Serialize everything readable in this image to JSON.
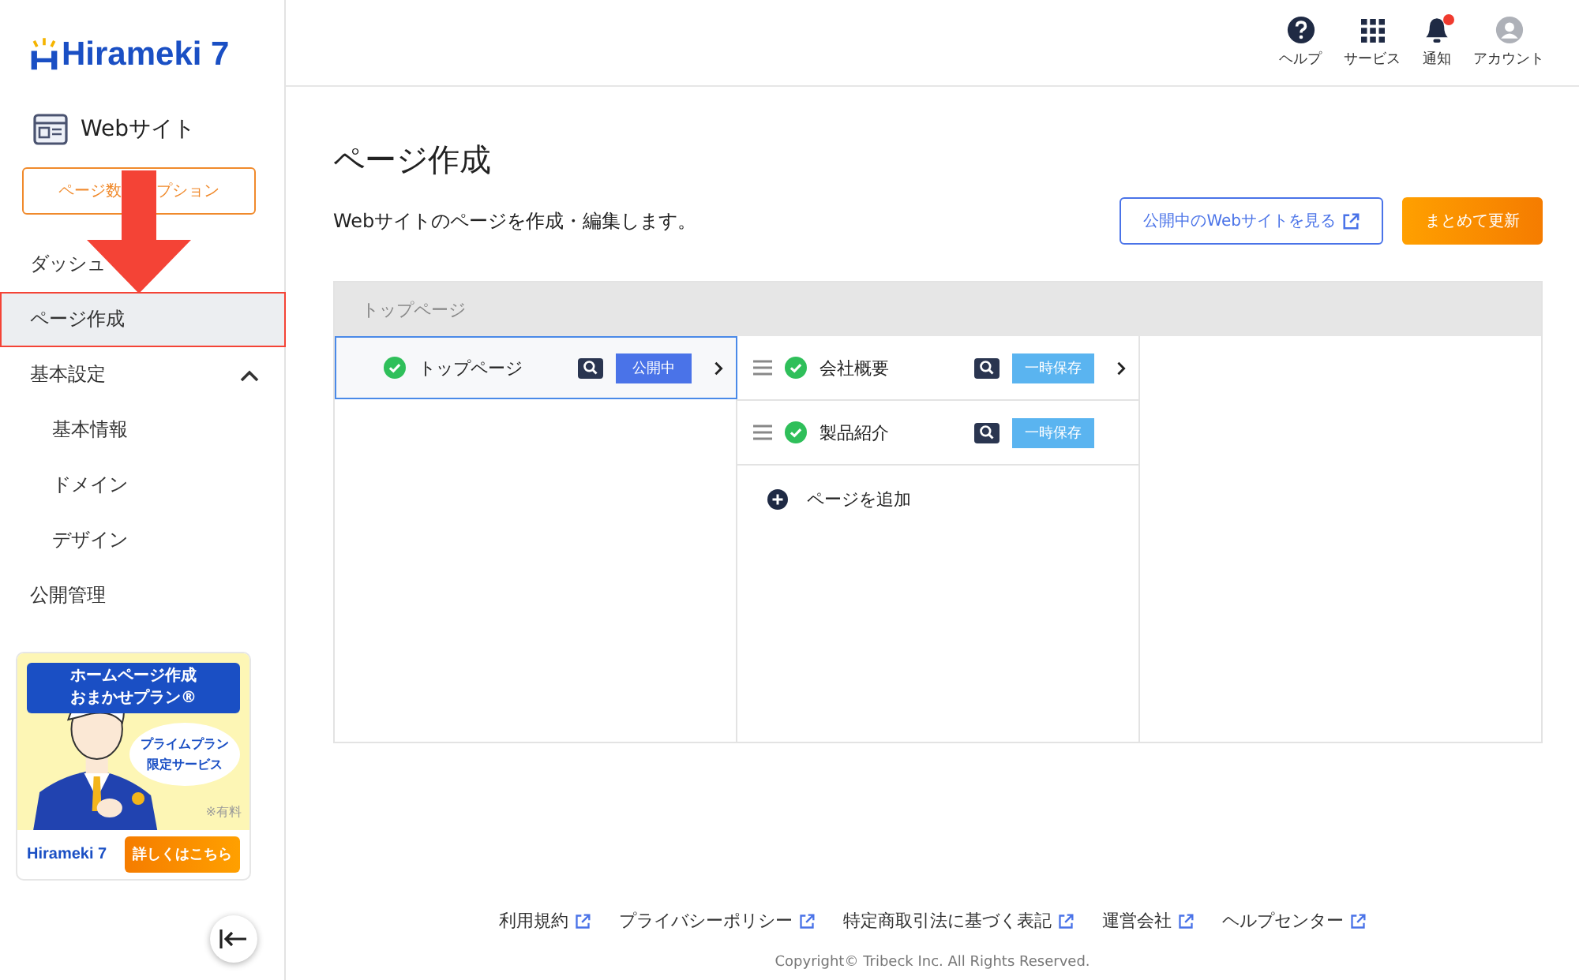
{
  "sidebar": {
    "logo": "Hirameki 7",
    "site_label": "Webサイト",
    "option_button": {
      "parts": [
        "ページ数",
        "プション"
      ]
    },
    "nav": [
      {
        "label": "ダッシュ",
        "selected": false
      },
      {
        "label": "ページ作成",
        "selected": true
      },
      {
        "label": "基本設定",
        "selected": false,
        "expanded": true,
        "children": [
          {
            "label": "基本情報",
            "selected": false
          },
          {
            "label": "ドメイン",
            "selected": false
          },
          {
            "label": "デザイン",
            "selected": false
          }
        ]
      },
      {
        "label": "公開管理",
        "selected": false
      }
    ],
    "banner": {
      "title_lines": [
        "ホームページ作成",
        "おまかせプラン®"
      ],
      "bubble_lines": [
        "プライムプラン",
        "限定サービス"
      ],
      "note": "※有料",
      "logo": "Hirameki 7",
      "cta": "詳しくはこちら"
    }
  },
  "header": {
    "items": [
      {
        "kind": "help",
        "label": "ヘルプ"
      },
      {
        "kind": "grid",
        "label": "サービス"
      },
      {
        "kind": "bell",
        "label": "通知",
        "badge": true
      },
      {
        "kind": "account",
        "label": "アカウント"
      }
    ]
  },
  "page": {
    "title": "ページ作成",
    "description": "Webサイトのページを作成・編集します。",
    "view_button": "公開中のWebサイトを見る",
    "update_button": "まとめて更新"
  },
  "tree": {
    "breadcrumb": "トップページ",
    "columns": [
      {
        "items": [
          {
            "label": "トップページ",
            "selected": true,
            "draggable": false,
            "kind": "published",
            "status": "公開中",
            "has_children": true
          }
        ]
      },
      {
        "items": [
          {
            "label": "会社概要",
            "selected": false,
            "draggable": true,
            "kind": "draft",
            "status": "一時保存",
            "has_children": true
          },
          {
            "label": "製品紹介",
            "selected": false,
            "draggable": true,
            "kind": "draft",
            "status": "一時保存",
            "has_children": false
          }
        ],
        "add_label": "ページを追加"
      },
      {}
    ]
  },
  "footer": {
    "links": [
      "利用規約",
      "プライバシーポリシー",
      "特定商取引法に基づく表記",
      "運営会社",
      "ヘルプセンター"
    ],
    "copyright": "Copyright© Tribeck Inc. All Rights Reserved."
  }
}
